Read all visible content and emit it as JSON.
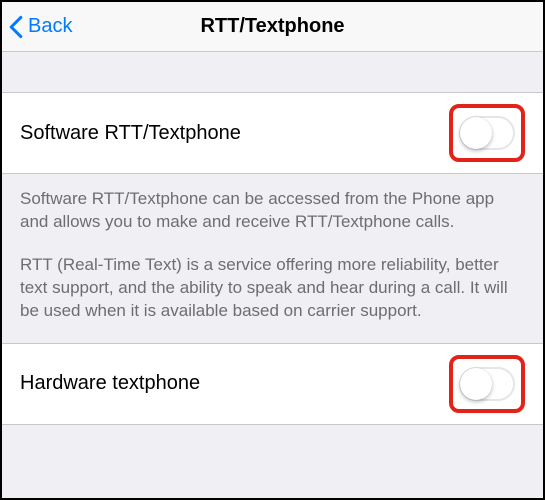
{
  "navbar": {
    "back_label": "Back",
    "title": "RTT/Textphone"
  },
  "software": {
    "label": "Software RTT/Textphone",
    "enabled": false
  },
  "description": {
    "p1": "Software RTT/Textphone can be accessed from the Phone app and allows you to make and receive RTT/Textphone calls.",
    "p2": "RTT (Real-Time Text) is a service offering more reliability, better text support, and the ability to speak and hear during a call. It will be used when it is available based on carrier support."
  },
  "hardware": {
    "label": "Hardware textphone",
    "enabled": false
  }
}
